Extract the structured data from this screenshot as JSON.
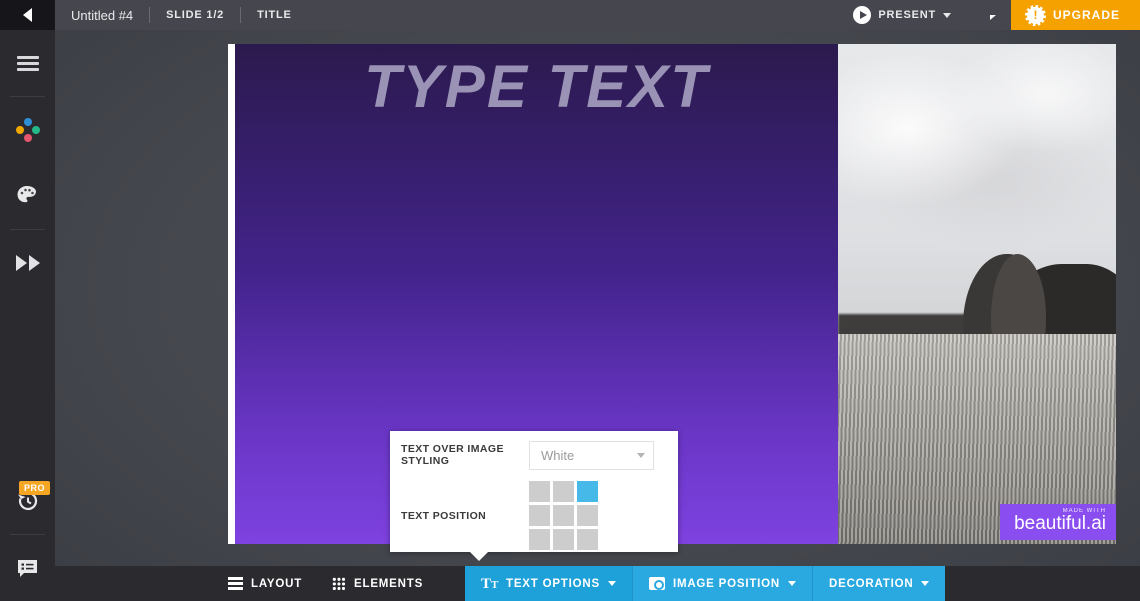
{
  "header": {
    "back_icon": "chevron-left-icon",
    "doc_title": "Untitled #4",
    "slide_counter": "SLIDE 1/2",
    "slide_type": "TITLE",
    "present_label": "PRESENT",
    "play_icon": "play-icon",
    "comment_icon": "comment-bubble-icon",
    "upgrade_label": "UPGRADE",
    "upgrade_icon": "alert-badge-icon",
    "upgrade_color": "#f5a100"
  },
  "sidebar": {
    "items": [
      {
        "icon": "hamburger-menu-icon",
        "name": "menu"
      },
      {
        "icon": "color-dots-icon",
        "name": "theme-colors"
      },
      {
        "icon": "palette-icon",
        "name": "palette"
      },
      {
        "icon": "fast-forward-icon",
        "name": "transitions"
      }
    ],
    "lower_items": [
      {
        "icon": "version-history-icon",
        "name": "version-history",
        "badge": "PRO"
      },
      {
        "icon": "notes-icon",
        "name": "notes"
      }
    ],
    "badge_color": "#f5a623"
  },
  "slide": {
    "title_placeholder": "TYPE TEXT",
    "gradient_top": "#2b1a4d",
    "gradient_bottom": "#7e42e0",
    "photo_alt": "elephant-in-grassland-photo",
    "watermark": {
      "small": "MADE WITH",
      "big": "beautiful.ai",
      "color": "#8a4ef0"
    }
  },
  "panel": {
    "styling_label": "TEXT OVER IMAGE STYLING",
    "styling_value": "White",
    "styling_options": [
      "White"
    ],
    "position_label": "TEXT POSITION",
    "position_selected_index": 2,
    "selected_color": "#46b9e8",
    "cell_color": "#cdcdcd"
  },
  "toolbar": {
    "layout_label": "LAYOUT",
    "layout_icon": "layout-rows-icon",
    "elements_label": "ELEMENTS",
    "elements_icon": "grid-dots-icon",
    "buttons": [
      {
        "label": "TEXT OPTIONS",
        "icon": "text-format-icon",
        "active": true
      },
      {
        "label": "IMAGE POSITION",
        "icon": "camera-icon",
        "active": false
      },
      {
        "label": "DECORATION",
        "icon": "",
        "active": false
      }
    ],
    "accent": "#29a9e0"
  }
}
